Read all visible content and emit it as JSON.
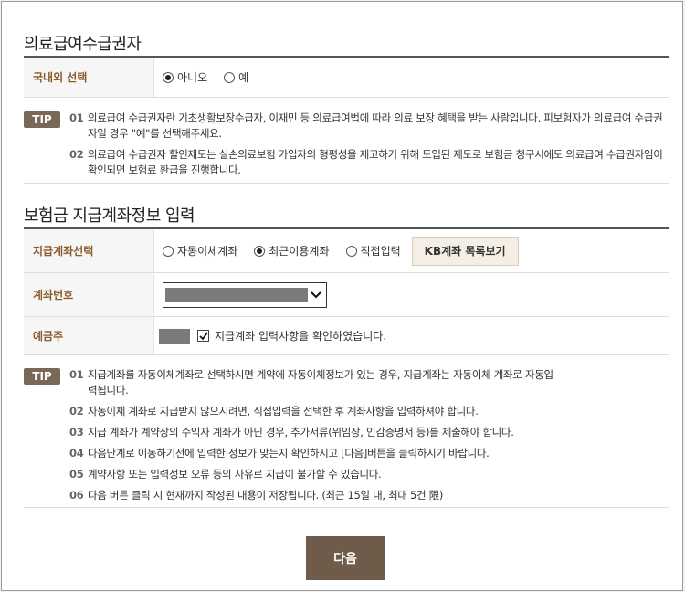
{
  "section1": {
    "title": "의료급여수급권자",
    "row_label": "국내외 선택",
    "options": [
      {
        "label": "아니오",
        "selected": true
      },
      {
        "label": "예",
        "selected": false
      }
    ],
    "tip_badge": "TIP",
    "tips": [
      {
        "num": "01",
        "text": "의료급여 수급권자란 기초생활보장수급자, 이재민 등 의료급여법에 따라 의료 보장 혜택을 받는 사람입니다. 피보험자가 의료급여 수급권자일 경우 \"예\"를 선택해주세요."
      },
      {
        "num": "02",
        "text": "의료급여 수급권자 할인제도는 실손의료보험 가입자의 형평성을 제고하기 위해 도입된 제도로 보험금 청구시에도 의료급여 수급권자임이 확인되면 보험료 환급을 진행합니다."
      }
    ]
  },
  "section2": {
    "title": "보험금 지급계좌정보 입력",
    "account_select": {
      "label": "지급계좌선택",
      "options": [
        {
          "label": "자동이체계좌",
          "selected": false
        },
        {
          "label": "최근이용계좌",
          "selected": true
        },
        {
          "label": "직접입력",
          "selected": false
        }
      ],
      "kb_button": "KB계좌 목록보기"
    },
    "account_number": {
      "label": "계좌번호"
    },
    "holder": {
      "label": "예금주",
      "confirm_text": "지급계좌 입력사항을 확인하였습니다.",
      "checked": true
    },
    "tip_badge": "TIP",
    "tips": [
      {
        "num": "01",
        "text": "지급계좌를 자동이체계좌로 선택하시면 계약에 자동이체정보가 있는 경우, 지급계좌는 자동이체 계좌로 자동입력됩니다."
      },
      {
        "num": "02",
        "text": "자동이체 계좌로 지급받지 않으시려면, 직접입력을 선택한 후 계좌사항을 입력하셔야 합니다."
      },
      {
        "num": "03",
        "text": "지급 계좌가 계약상의 수익자 계좌가 아닌 경우, 추가서류(위임장, 인감증명서 등)를 제출해야 합니다."
      },
      {
        "num": "04",
        "text": "다음단계로 이동하기전에 입력한 정보가 맞는지 확인하시고 [다음]버튼을 클릭하시기 바랍니다."
      },
      {
        "num": "05",
        "text": "계약사항 또는 입력정보 오류 등의 사유로 지급이 불가할 수 있습니다."
      },
      {
        "num": "06",
        "text": "다음 버튼 클릭 시 현재까지 작성된 내용이 저장됩니다. (최근 15일 내, 최대 5건 限)"
      }
    ]
  },
  "next_button": "다음"
}
